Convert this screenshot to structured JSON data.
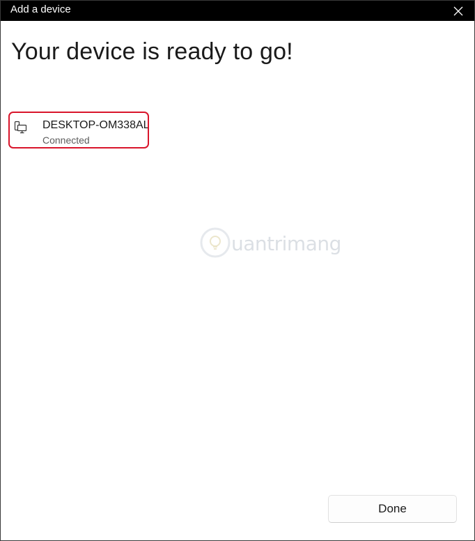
{
  "window": {
    "title": "Add a device"
  },
  "heading": "Your device is ready to go!",
  "device": {
    "name": "DESKTOP-OM338AL",
    "status": "Connected",
    "icon": "computer-phone-icon"
  },
  "watermark": {
    "text": "uantrimang"
  },
  "done_label": "Done",
  "colors": {
    "titlebar": "#000000",
    "highlight": "#d9152b"
  }
}
